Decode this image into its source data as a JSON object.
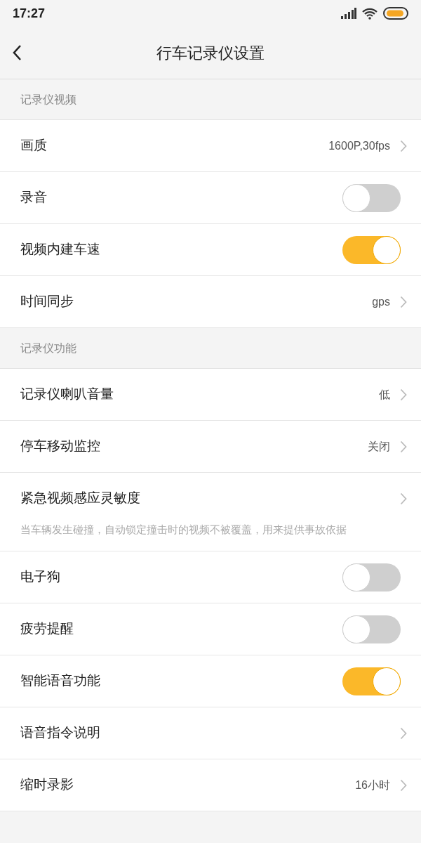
{
  "status_bar": {
    "time": "17:27"
  },
  "header": {
    "title": "行车记录仪设置"
  },
  "sections": [
    {
      "title": "记录仪视频",
      "items": [
        {
          "kind": "link",
          "label": "画质",
          "value": "1600P,30fps"
        },
        {
          "kind": "toggle",
          "label": "录音",
          "on": false
        },
        {
          "kind": "toggle",
          "label": "视频内建车速",
          "on": true
        },
        {
          "kind": "link",
          "label": "时间同步",
          "value": "gps"
        }
      ]
    },
    {
      "title": "记录仪功能",
      "items": [
        {
          "kind": "link",
          "label": "记录仪喇叭音量",
          "value": "低"
        },
        {
          "kind": "link",
          "label": "停车移动监控",
          "value": "关闭"
        },
        {
          "kind": "link",
          "label": "紧急视频感应灵敏度",
          "description": "当车辆发生碰撞，自动锁定撞击时的视频不被覆盖，用来提供事故依据"
        },
        {
          "kind": "toggle",
          "label": "电子狗",
          "on": false
        },
        {
          "kind": "toggle",
          "label": "疲劳提醒",
          "on": false
        },
        {
          "kind": "toggle",
          "label": "智能语音功能",
          "on": true
        },
        {
          "kind": "link",
          "label": "语音指令说明"
        },
        {
          "kind": "link",
          "label": "缩时录影",
          "value": "16小时"
        }
      ]
    }
  ]
}
